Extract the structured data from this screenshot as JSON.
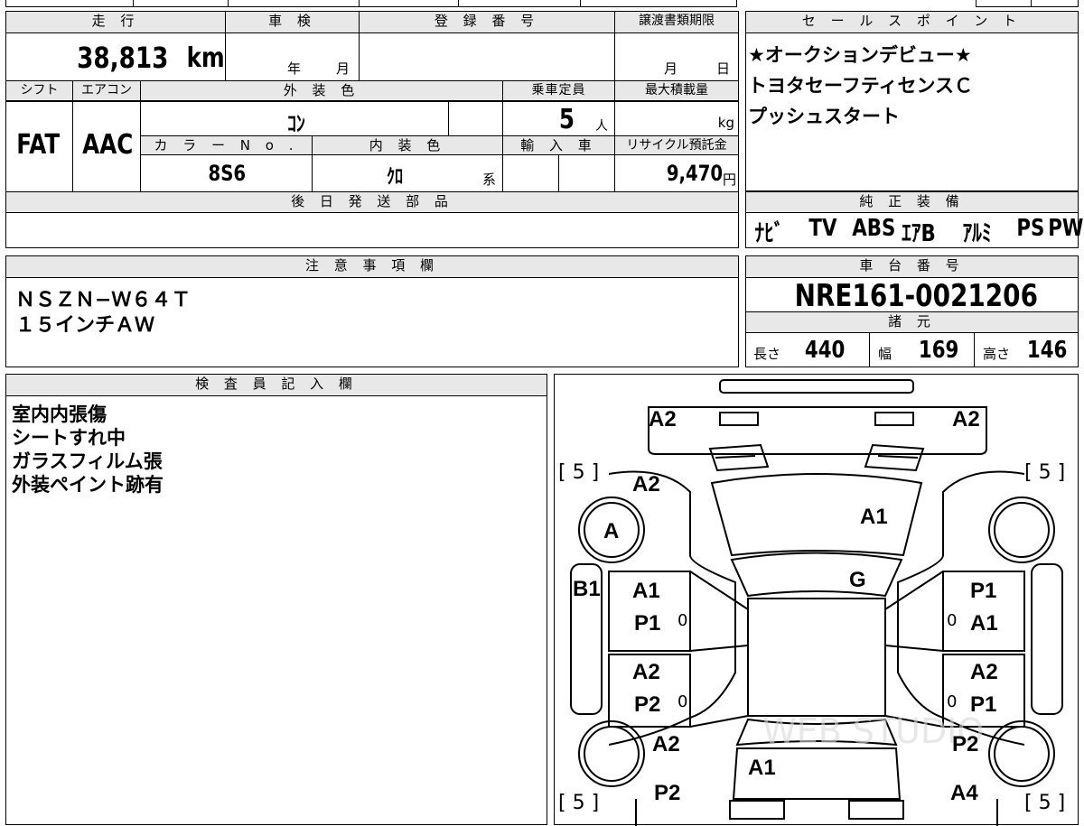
{
  "vehicle": {
    "mileage_header": "走 行",
    "mileage": "38,813",
    "mileage_unit": "km",
    "inspection_header": "車 検",
    "inspection_year": "年",
    "inspection_month": "月",
    "registration_header": "登 録 番 号",
    "transfer_header": "譲渡書類期限",
    "transfer_month": "月",
    "transfer_day": "日",
    "shift_header": "シフト",
    "shift": "FAT",
    "ac_header": "エアコン",
    "ac": "AAC",
    "exterior_color_header": "外 装 色",
    "exterior_color": "ｺﾝ",
    "capacity_header": "乗車定員",
    "capacity": "5",
    "capacity_unit": "人",
    "max_load_header": "最大積載量",
    "max_load_unit": "kg",
    "color_no_header": "カ ラ ー N o .",
    "color_no": "8S6",
    "interior_color_header": "内 装 色",
    "interior_color": "ｸﾛ",
    "interior_suffix": "系",
    "import_header": "輸 入 車",
    "recycle_header": "リサイクル預託金",
    "recycle_fee": "9,470",
    "recycle_unit": "円",
    "parts_header": "後 日 発 送 部 品"
  },
  "sales_points": {
    "header": "セ ー ル ス ポ イ ン ト",
    "lines": [
      "★オークションデビュー★",
      "トヨタセーフティセンスＣ",
      "プッシュスタート"
    ]
  },
  "equipment": {
    "header": "純 正 装 備",
    "items": [
      "ﾅﾋﾞ",
      "TV",
      "ABS",
      "ｴｱB",
      "ｱﾙﾐ",
      "PS",
      "PW"
    ]
  },
  "notes": {
    "header": "注 意 事 項 欄",
    "lines": [
      "ＮＳＺＮ−Ｗ６４Ｔ",
      "１５インチＡＷ"
    ]
  },
  "chassis": {
    "header": "車 台 番 号",
    "number": "NRE161-0021206",
    "spec_header": "諸 元",
    "length_label": "長さ",
    "length": "440",
    "width_label": "幅",
    "width": "169",
    "height_label": "高さ",
    "height": "146"
  },
  "inspector": {
    "header": "検 査 員 記 入 欄",
    "lines": [
      "室内内張傷",
      "シートすれ中",
      "ガラスフィルム張",
      "外装ペイント跡有"
    ]
  },
  "diagram": {
    "tire_fl": "[ 5 ]",
    "tire_fr": "[ 5 ]",
    "tire_rl": "[ 5 ]",
    "tire_rr": "[ 5 ]",
    "bumper_front_left": "A2",
    "bumper_front_right": "A2",
    "fender_front_left": "A2",
    "hood": "A1",
    "wheel_front_left": "A",
    "windshield": "G",
    "pillar_left": "B1",
    "door_fl_1": "A1",
    "door_fl_2": "P1",
    "door_fr_1": "P1",
    "door_fr_2": "A1",
    "door_rl_1": "A2",
    "door_rl_2": "P2",
    "door_rr_1": "A2",
    "door_rr_2": "P1",
    "quarter_rl": "A2",
    "quarter_rr": "P2",
    "trunk": "A1",
    "rear_left": "P2",
    "rear_right": "A4",
    "mark_0": "0",
    "watermark": "WEB STUDIO"
  }
}
